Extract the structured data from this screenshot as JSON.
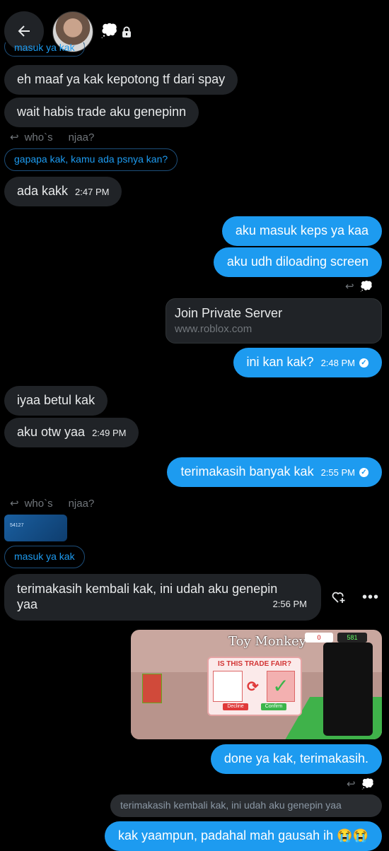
{
  "header": {
    "back_icon": "arrow-left-icon",
    "avatar_icon": "avatar",
    "emoji": "💭",
    "lock_icon": "lock-icon",
    "partial_quote": "masuk ya kak"
  },
  "messages": {
    "m1": "eh maaf ya kak kepotong tf dari spay",
    "m2": "wait habis trade aku genepinn",
    "reply1_name": "who`s",
    "reply1_text": "njaa?",
    "q1": "gapapa kak, kamu ada psnya kan?",
    "m3": "ada kakk",
    "m3_time": "2:47 PM",
    "o1": "aku masuk keps ya kaa",
    "o2": "aku udh diloading screen",
    "link_title": "Join Private Server",
    "link_domain": "www.roblox.com",
    "o3": "ini kan kak?",
    "o3_time": "2:48 PM",
    "m4": "iyaa betul kak",
    "m5": "aku otw yaa",
    "m5_time": "2:49 PM",
    "o4": "terimakasih banyak kak",
    "o4_time": "2:55 PM",
    "reply2_name": "who`s",
    "reply2_text": "njaa?",
    "thumb_text": "54127",
    "q2": "masuk ya kak",
    "m6_line1": "terimakasih kembali kak, ini udah aku genepin",
    "m6_line2": "yaa",
    "m6_time": "2:56 PM",
    "game_title": "Toy Monkey",
    "trade_title": "IS THIS TRADE FAIR?",
    "trade_decline": "Decline",
    "trade_confirm": "Confirm",
    "coins_left": "0",
    "coins_right": "581",
    "o5": "done ya kak, terimakasih.",
    "gq": "terimakasih kembali kak, ini udah aku genepin yaa",
    "o6": "kak yaampun, padahal mah gausah ih 😭😭"
  },
  "colors": {
    "accent": "#1d9bf0",
    "bubble_in": "#202327",
    "background": "#000000"
  }
}
